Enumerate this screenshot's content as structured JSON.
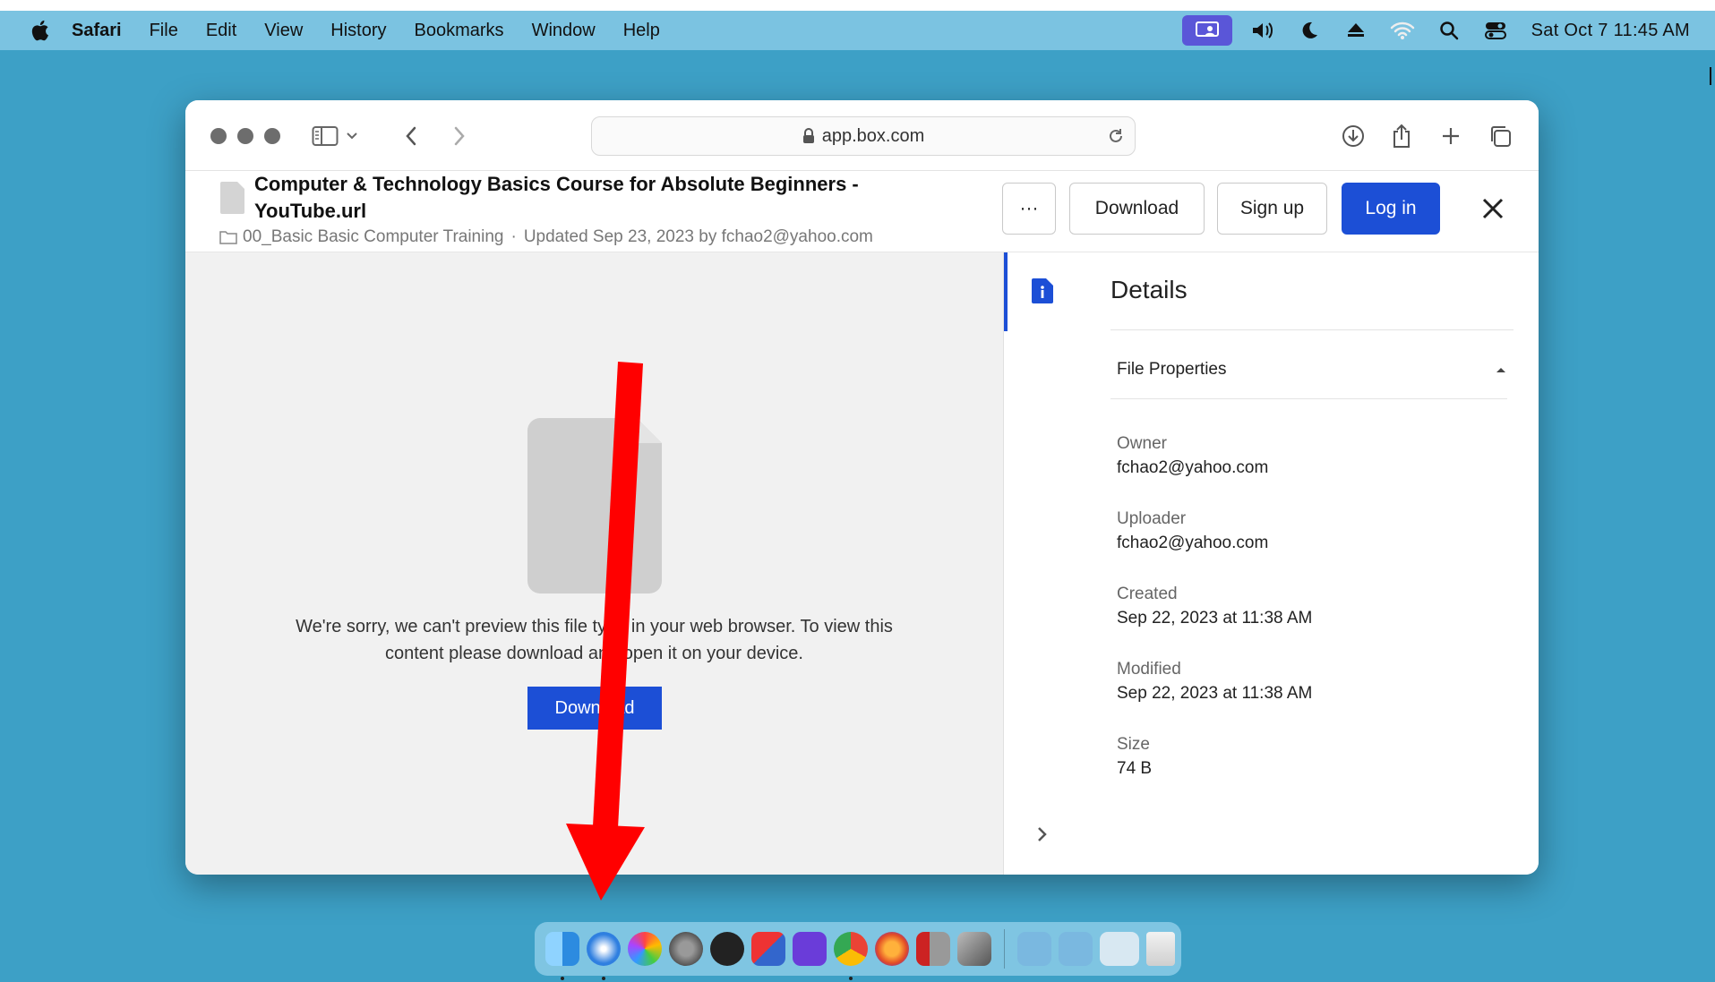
{
  "menubar": {
    "app_name": "Safari",
    "items": [
      "File",
      "Edit",
      "View",
      "History",
      "Bookmarks",
      "Window",
      "Help"
    ],
    "clock": "Sat Oct 7  11:45 AM",
    "icons": [
      "screen-share-icon",
      "volume-icon",
      "moon-icon",
      "eject-icon",
      "wifi-icon",
      "spotlight-search-icon",
      "control-center-icon"
    ]
  },
  "browser": {
    "url": "app.box.com"
  },
  "file_header": {
    "title": "Computer & Technology Basics Course for Absolute Beginners - YouTube.url",
    "folder": "00_Basic Basic Computer Training",
    "separator": "·",
    "updated": "Updated Sep 23, 2023 by fchao2@yahoo.com",
    "more_label": "···",
    "download_label": "Download",
    "signup_label": "Sign up",
    "login_label": "Log in"
  },
  "preview": {
    "message": "We're sorry, we can't preview this file type in your web browser. To view this content please download and open it on your device.",
    "download_label": "Download"
  },
  "details": {
    "heading": "Details",
    "section": "File Properties",
    "properties": [
      {
        "key": "Owner",
        "value": "fchao2@yahoo.com"
      },
      {
        "key": "Uploader",
        "value": "fchao2@yahoo.com"
      },
      {
        "key": "Created",
        "value": "Sep 22, 2023 at 11:38 AM"
      },
      {
        "key": "Modified",
        "value": "Sep 22, 2023 at 11:38 AM"
      },
      {
        "key": "Size",
        "value": "74 B"
      }
    ]
  },
  "dock": {
    "apps": [
      "finder",
      "safari",
      "photos",
      "system-settings",
      "activity-monitor",
      "screen-sharing",
      "imovie",
      "chrome",
      "firefox",
      "parallels",
      "virtualbox"
    ],
    "folders": [
      "downloads-folder",
      "applications-folder",
      "documents-folder",
      "trash"
    ]
  },
  "colors": {
    "desktop": "#3da0c6",
    "menubar": "#7bc3e1",
    "primary_button": "#1c4fd6",
    "annotation_arrow": "#ff0000"
  }
}
